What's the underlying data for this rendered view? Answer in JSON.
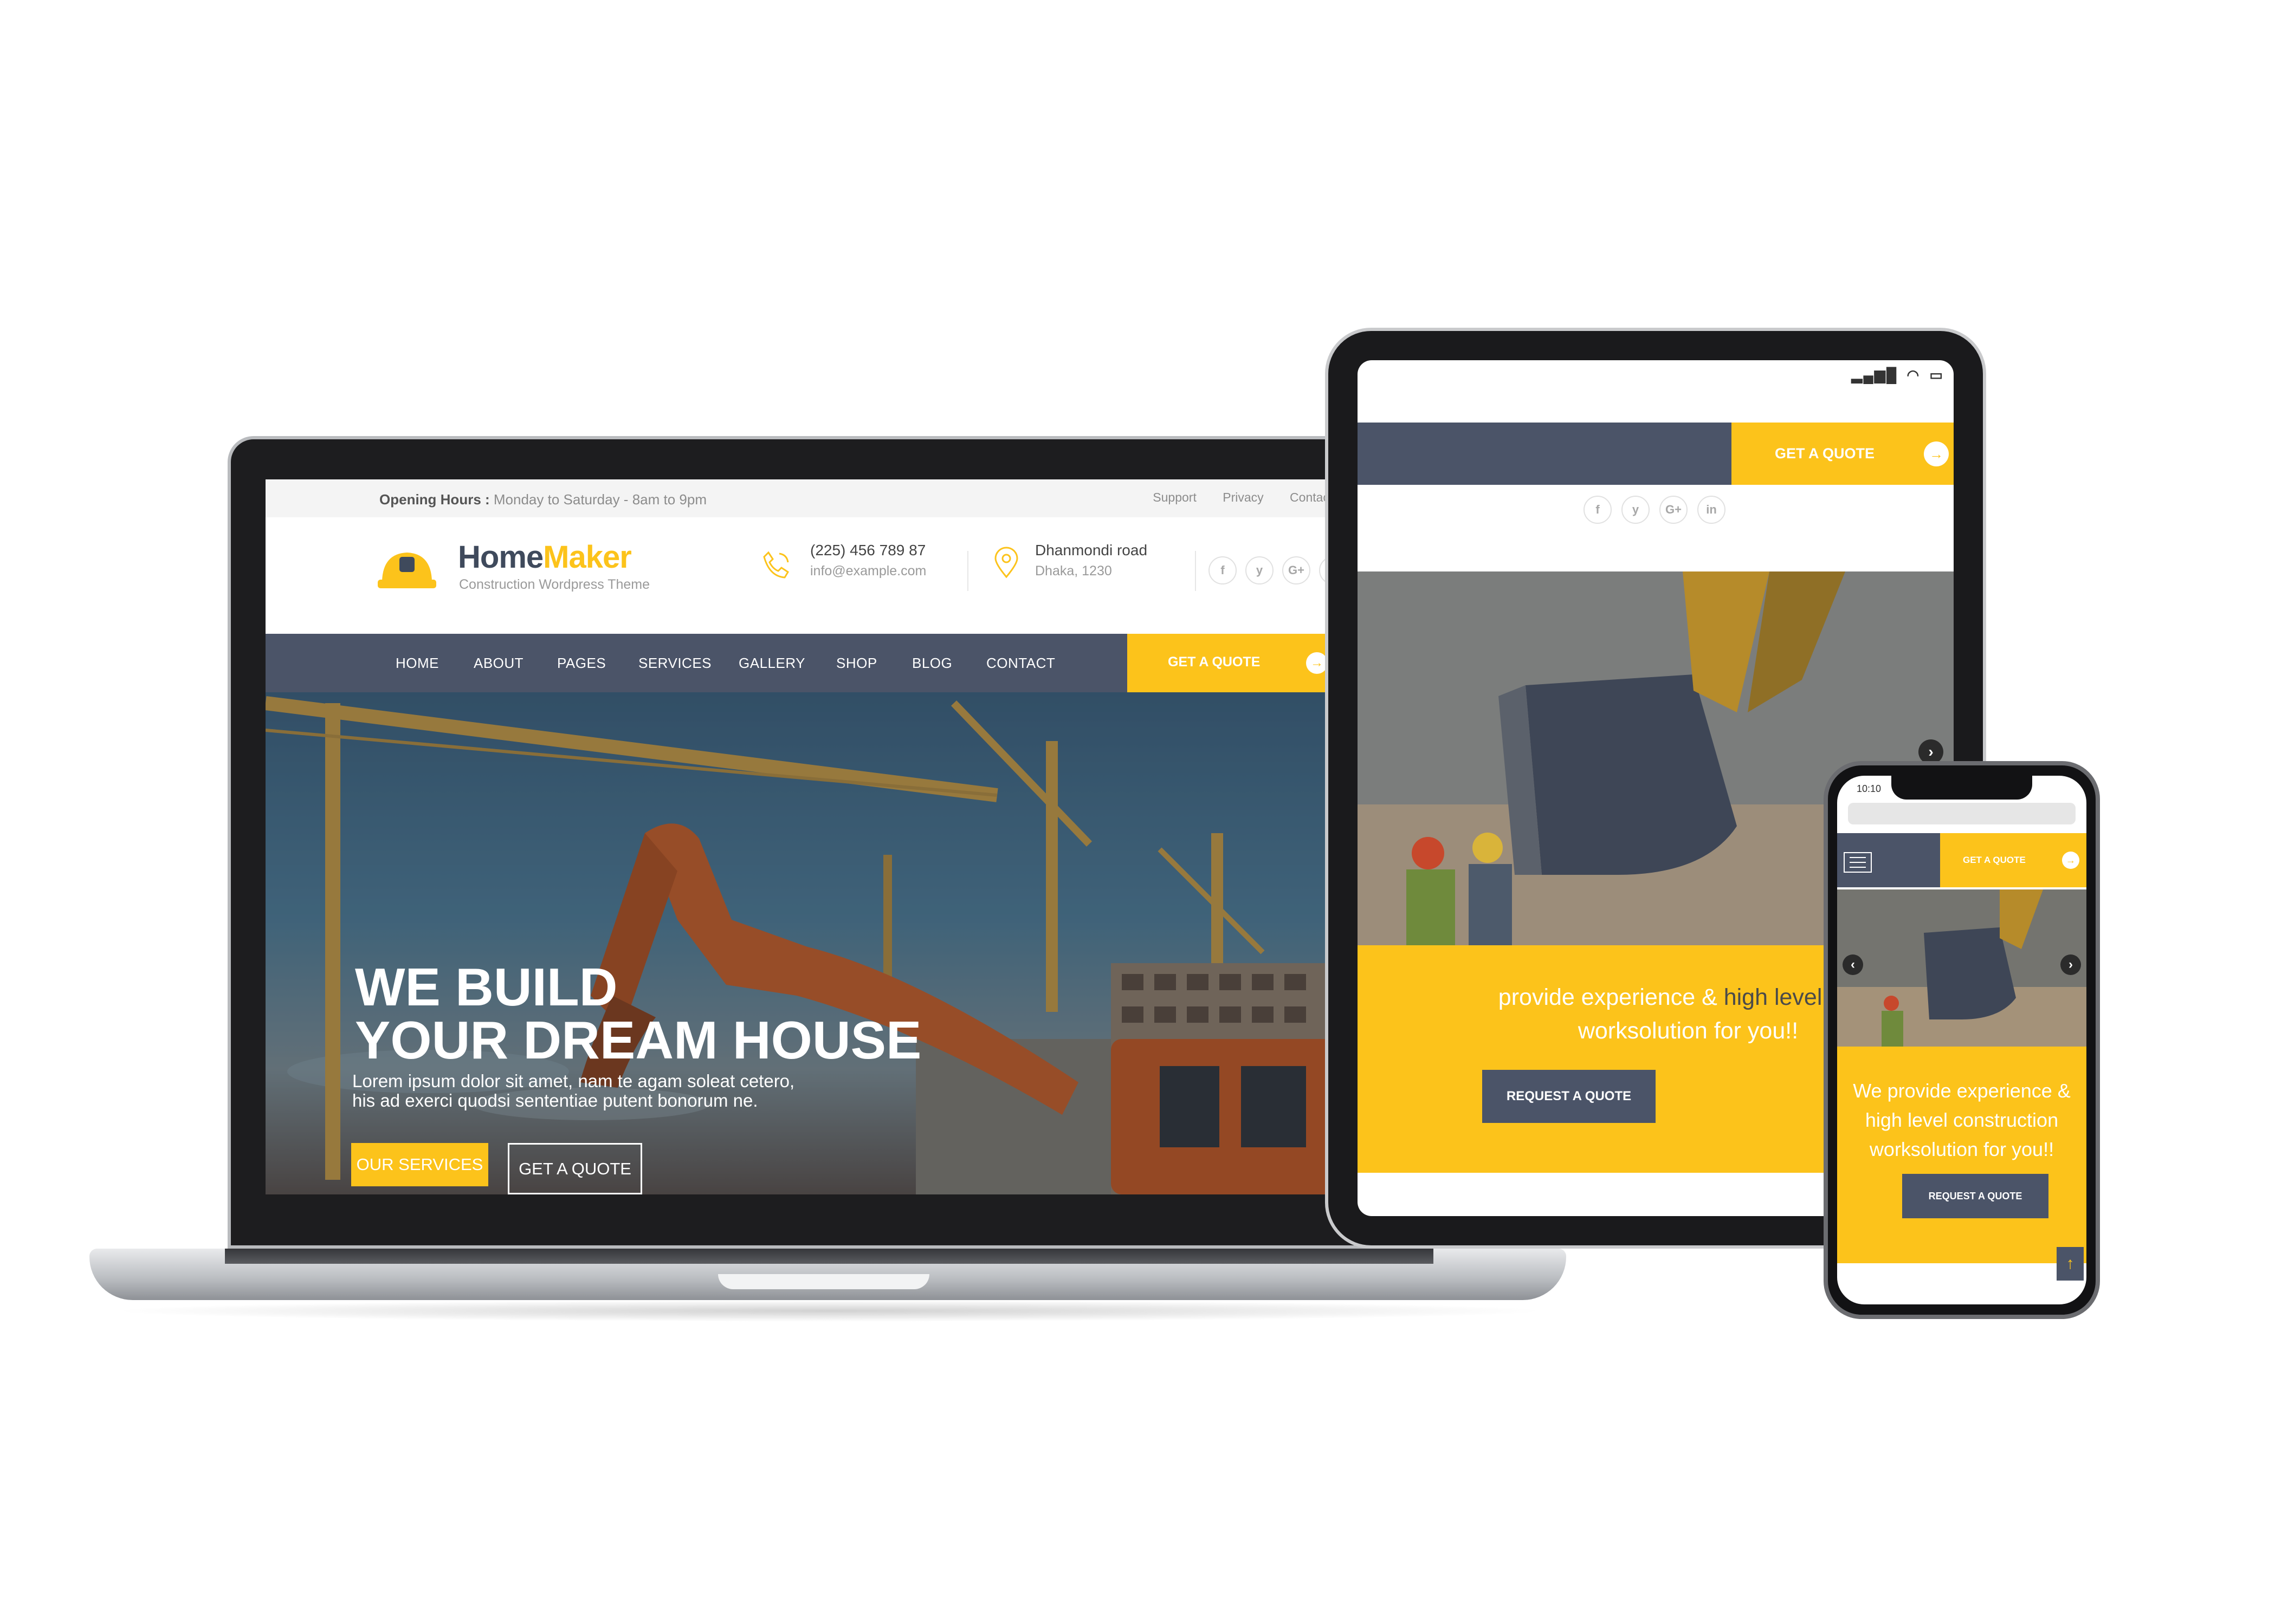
{
  "colors": {
    "accent": "#fcc31b",
    "nav_bg": "#4b5468",
    "brand_dark": "#3f4a5c"
  },
  "laptop": {
    "topbar": {
      "hours_label": "Opening Hours :",
      "hours_value": " Monday to Saturday - 8am to 9pm",
      "links": [
        "Support",
        "Privacy",
        "Contact us"
      ]
    },
    "logo": {
      "name_part1": "Home",
      "name_part2": "Maker",
      "tagline": "Construction Wordpress Theme"
    },
    "contact": {
      "phone": "(225) 456 789 87",
      "email": "info@example.com",
      "address_line1": "Dhanmondi road",
      "address_line2": "Dhaka, 1230"
    },
    "social": [
      "f",
      "y",
      "G+",
      "in"
    ],
    "nav": {
      "items": [
        "HOME",
        "ABOUT",
        "PAGES",
        "SERVICES",
        "GALLERY",
        "SHOP",
        "BLOG",
        "CONTACT"
      ],
      "quote_label": "GET A QUOTE"
    },
    "hero": {
      "title_line1": "WE BUILD",
      "title_line2": "YOUR DREAM HOUSE",
      "text_line1": "Lorem ipsum dolor sit amet, nam te agam soleat cetero,",
      "text_line2": "his ad exerci quodsi sententiae putent bonorum ne.",
      "services_button": "OUR SERVICES",
      "quote_button": "GET A QUOTE"
    }
  },
  "tablet": {
    "quote_label": "GET A QUOTE",
    "social": [
      "f",
      "y",
      "G+",
      "in"
    ],
    "band_text_part1": "provide experience & ",
    "band_text_part2": "high level cons",
    "band_text_line2": "worksolution for you!!",
    "request_button": "REQUEST A QUOTE"
  },
  "phone": {
    "time": "10:10",
    "quote_label": "GET A QUOTE",
    "band_text": "We provide experience & high level construction worksolution for you!!",
    "request_button": "REQUEST A QUOTE"
  }
}
